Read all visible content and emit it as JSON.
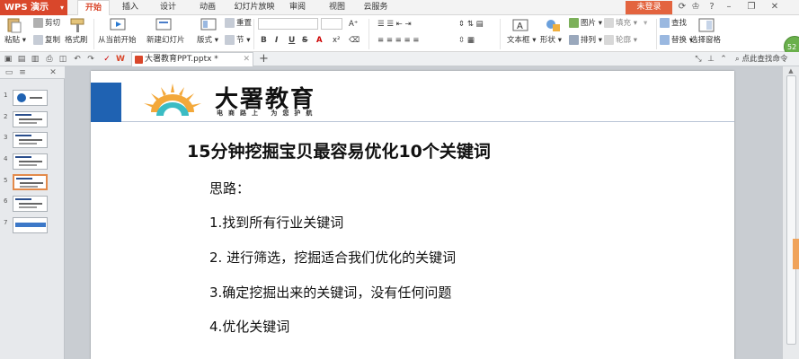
{
  "titlebar": {
    "app_label": "WPS 演示",
    "tabs": [
      "开始",
      "插入",
      "设计",
      "动画",
      "幻灯片放映",
      "审阅",
      "视图",
      "云服务"
    ],
    "login_label": "未登录"
  },
  "ribbon": {
    "paste": "粘贴",
    "cut": "剪切",
    "copy": "复制",
    "format_painter": "格式刷",
    "from_current": "从当前开始",
    "new_slide": "新建幻灯片",
    "layout": "版式",
    "reset": "重置",
    "section": "节",
    "textbox": "文本框",
    "shape": "形状",
    "picture": "图片",
    "fill": "填充",
    "arrange": "排列",
    "outline": "轮廓",
    "find": "查找",
    "replace": "替换",
    "select_pane": "选择窗格",
    "font_name": "",
    "font_size": "",
    "format_letters": [
      "B",
      "I",
      "U",
      "S"
    ],
    "hint_badge": "52"
  },
  "docbar": {
    "doc_tab": "大署教育PPT.pptx *",
    "search_cmd": "点此查找命令"
  },
  "thumbnails": [
    "1",
    "2",
    "3",
    "4",
    "5",
    "6",
    "7"
  ],
  "slide": {
    "logo_text": "大署教育",
    "logo_sub": "电商路上 为您护航",
    "title": "15分钟挖掘宝贝最容易优化10个关键词",
    "lines": [
      "思路：",
      "1.找到所有行业关键词",
      "2. 进行筛选，挖掘适合我们优化的关键词",
      "3.确定挖掘出来的关键词，没有任何问题",
      "4.优化关键词"
    ]
  },
  "colors": {
    "accent": "#d9472b",
    "slide_blue": "#1f62b2",
    "logo_orange": "#f3a83a",
    "logo_teal": "#3bbcc4"
  }
}
